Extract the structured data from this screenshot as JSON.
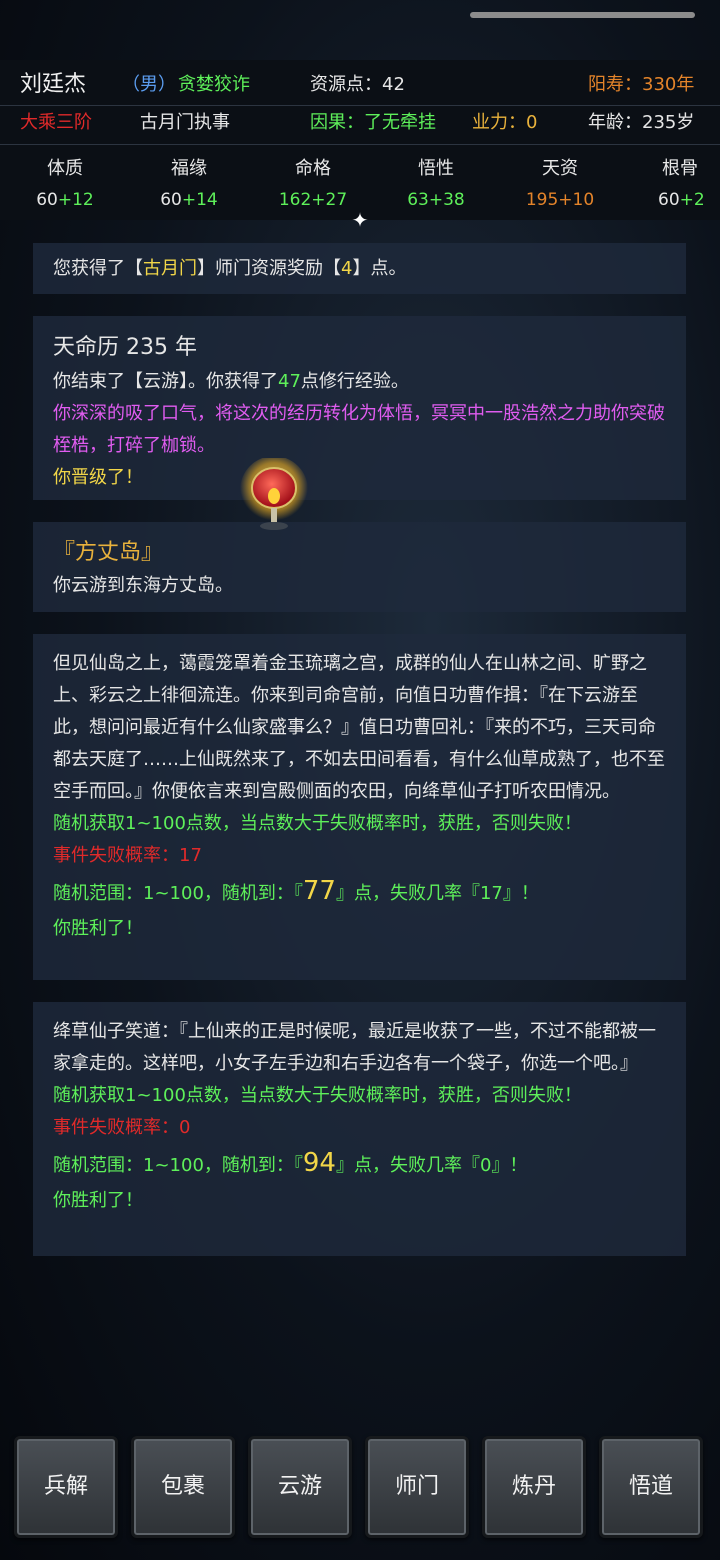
{
  "header": {
    "name": "刘廷杰",
    "gender": "（男）",
    "trait": "贪婪狡诈",
    "resource_points": "资源点：42",
    "lifespan": "阳寿：330年",
    "realm": "大乘三阶",
    "position": "古月门执事",
    "karma": "因果：了无牵挂",
    "merit": "业力：0",
    "age": "年龄：235岁"
  },
  "stats": [
    {
      "label": "体质",
      "base": "60",
      "bonus": "+12"
    },
    {
      "label": "福缘",
      "base": "60",
      "bonus": "+14"
    },
    {
      "label": "命格",
      "base": "162",
      "bonus": "+27"
    },
    {
      "label": "悟性",
      "base": "63",
      "bonus": "+38"
    },
    {
      "label": "天资",
      "base": "195",
      "bonus": "+10"
    },
    {
      "label": "根骨",
      "base": "60",
      "bonus": "+2"
    }
  ],
  "log": {
    "reward": {
      "pre": "您获得了【",
      "sect": "古月门",
      "mid": "】师门资源奖励【",
      "num": "4",
      "post": "】点。"
    },
    "year_card": {
      "year": "天命历 235 年",
      "exp_pre": "你结束了【云游】。你获得了",
      "exp_num": "47",
      "exp_post": "点修行经验。",
      "breakthrough": "你深深的吸了口气，将这次的经历转化为体悟，冥冥中一股浩然之力助你突破桎梏，打碎了枷锁。",
      "levelup": "你晋级了！"
    },
    "location_card": {
      "place": "『方丈岛』",
      "desc": "你云游到东海方丈岛。"
    },
    "event1": {
      "story": "但见仙岛之上，蔼霞笼罩着金玉琉璃之宫，成群的仙人在山林之间、旷野之上、彩云之上徘徊流连。你来到司命宫前，向值日功曹作揖：『在下云游至此，想问问最近有什么仙家盛事么？』值日功曹回礼：『来的不巧，三天司命都去天庭了……上仙既然来了，不如去田间看看，有什么仙草成熟了，也不至空手而回。』你便依言来到宫殿侧面的农田，向绛草仙子打听农田情况。",
      "rule": "随机获取1~100点数，当点数大于失败概率时，获胜，否则失败！",
      "fail_rate": "事件失败概率：17",
      "roll_pre": "随机范围：1~100，随机到：『",
      "roll_num": "77",
      "roll_post": "』点，失败几率『17』！",
      "result": "你胜利了！"
    },
    "event2": {
      "story": "绛草仙子笑道：『上仙来的正是时候呢，最近是收获了一些，不过不能都被一家拿走的。这样吧，小女子左手边和右手边各有一个袋子，你选一个吧。』",
      "rule": "随机获取1~100点数，当点数大于失败概率时，获胜，否则失败！",
      "fail_rate": "事件失败概率：0",
      "roll_pre": "随机范围：1~100，随机到：『",
      "roll_num": "94",
      "roll_post": "』点，失败几率『0』！",
      "result": "你胜利了！"
    }
  },
  "actions": [
    "兵解",
    "包裹",
    "云游",
    "师门",
    "炼丹",
    "悟道"
  ],
  "colors": {
    "gold": "#e9b23c",
    "green": "#5ef05a",
    "magenta": "#e05cf0",
    "red": "#e02a2a",
    "yellow": "#f2d648",
    "orange": "#e4842a"
  }
}
